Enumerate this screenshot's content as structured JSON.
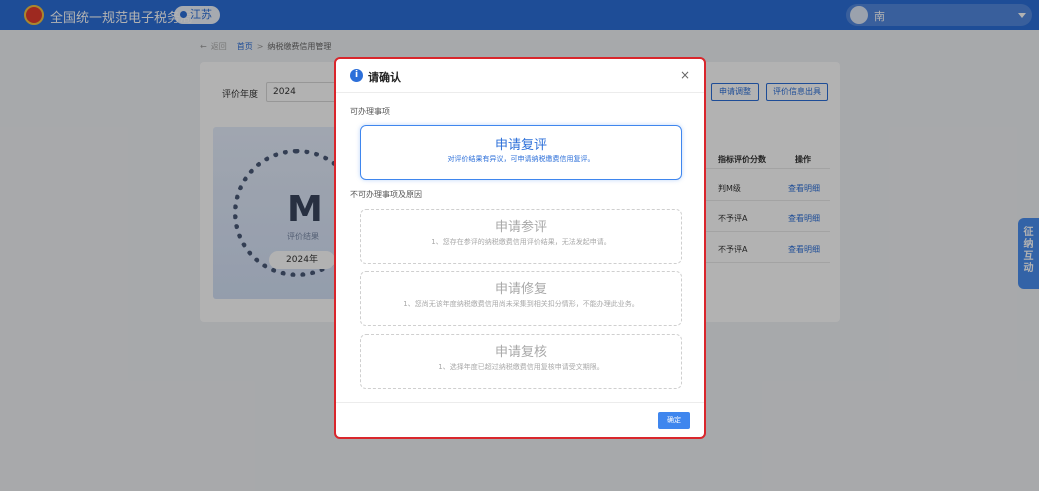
{
  "header": {
    "site_title": "全国统一规范电子税务局",
    "region": "江苏",
    "user_name": "南"
  },
  "breadcrumb": {
    "back": "返回",
    "home": "首页",
    "separator": ">",
    "current": "纳税缴费信用管理"
  },
  "filters": {
    "year_label": "评价年度",
    "year_value": "2024",
    "apply_adjust": "申请调整",
    "export_report": "评价信息出具"
  },
  "result": {
    "grade": "M",
    "caption": "评价结果",
    "year": "2024年"
  },
  "table": {
    "headers": [
      "指标评价分数",
      "操作"
    ],
    "rows": [
      {
        "score": "判M级",
        "action": "查看明细"
      },
      {
        "score": "不予评A",
        "action": "查看明细"
      },
      {
        "score": "不予评A",
        "action": "查看明细"
      }
    ]
  },
  "side_tab": {
    "chars": [
      "征",
      "纳",
      "互",
      "动"
    ]
  },
  "modal": {
    "title": "请确认",
    "close": "×",
    "available_label": "可办理事项",
    "available": {
      "title": "申请复评",
      "desc": "对评价结果有异议，可申请纳税缴费信用复评。"
    },
    "unavailable_label": "不可办理事项及原因",
    "unavailable": [
      {
        "title": "申请参评",
        "desc": "1、您存在参评的纳税缴费信用评价结果，无法发起申请。"
      },
      {
        "title": "申请修复",
        "desc": "1、您尚无该年度纳税缴费信用尚未采集到相关扣分情形，不能办理此业务。"
      },
      {
        "title": "申请复核",
        "desc": "1、选择年度已超过纳税缴费信用复核申请受文期限。"
      }
    ],
    "confirm": "确定"
  },
  "colors": {
    "header_blue": "#2c6fd9",
    "accent_blue": "#3f86ee",
    "highlight_red": "#d9262c"
  }
}
